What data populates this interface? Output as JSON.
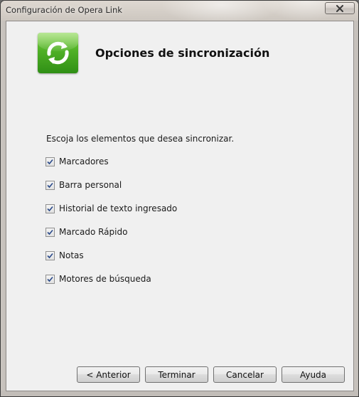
{
  "window": {
    "title": "Configuración de Opera Link"
  },
  "header": {
    "title": "Opciones de sincronización",
    "icon": "sync-icon"
  },
  "instructions": "Escoja los elementos que desea sincronizar.",
  "sync_items": [
    {
      "label": "Marcadores",
      "checked": true
    },
    {
      "label": "Barra personal",
      "checked": true
    },
    {
      "label": "Historial de texto ingresado",
      "checked": true
    },
    {
      "label": "Marcado Rápido",
      "checked": true
    },
    {
      "label": "Notas",
      "checked": true
    },
    {
      "label": "Motores de búsqueda",
      "checked": true
    }
  ],
  "buttons": {
    "back": "< Anterior",
    "finish": "Terminar",
    "cancel": "Cancelar",
    "help": "Ayuda"
  },
  "colors": {
    "icon_green": "#4fb026",
    "check_blue": "#2b4a8a"
  }
}
